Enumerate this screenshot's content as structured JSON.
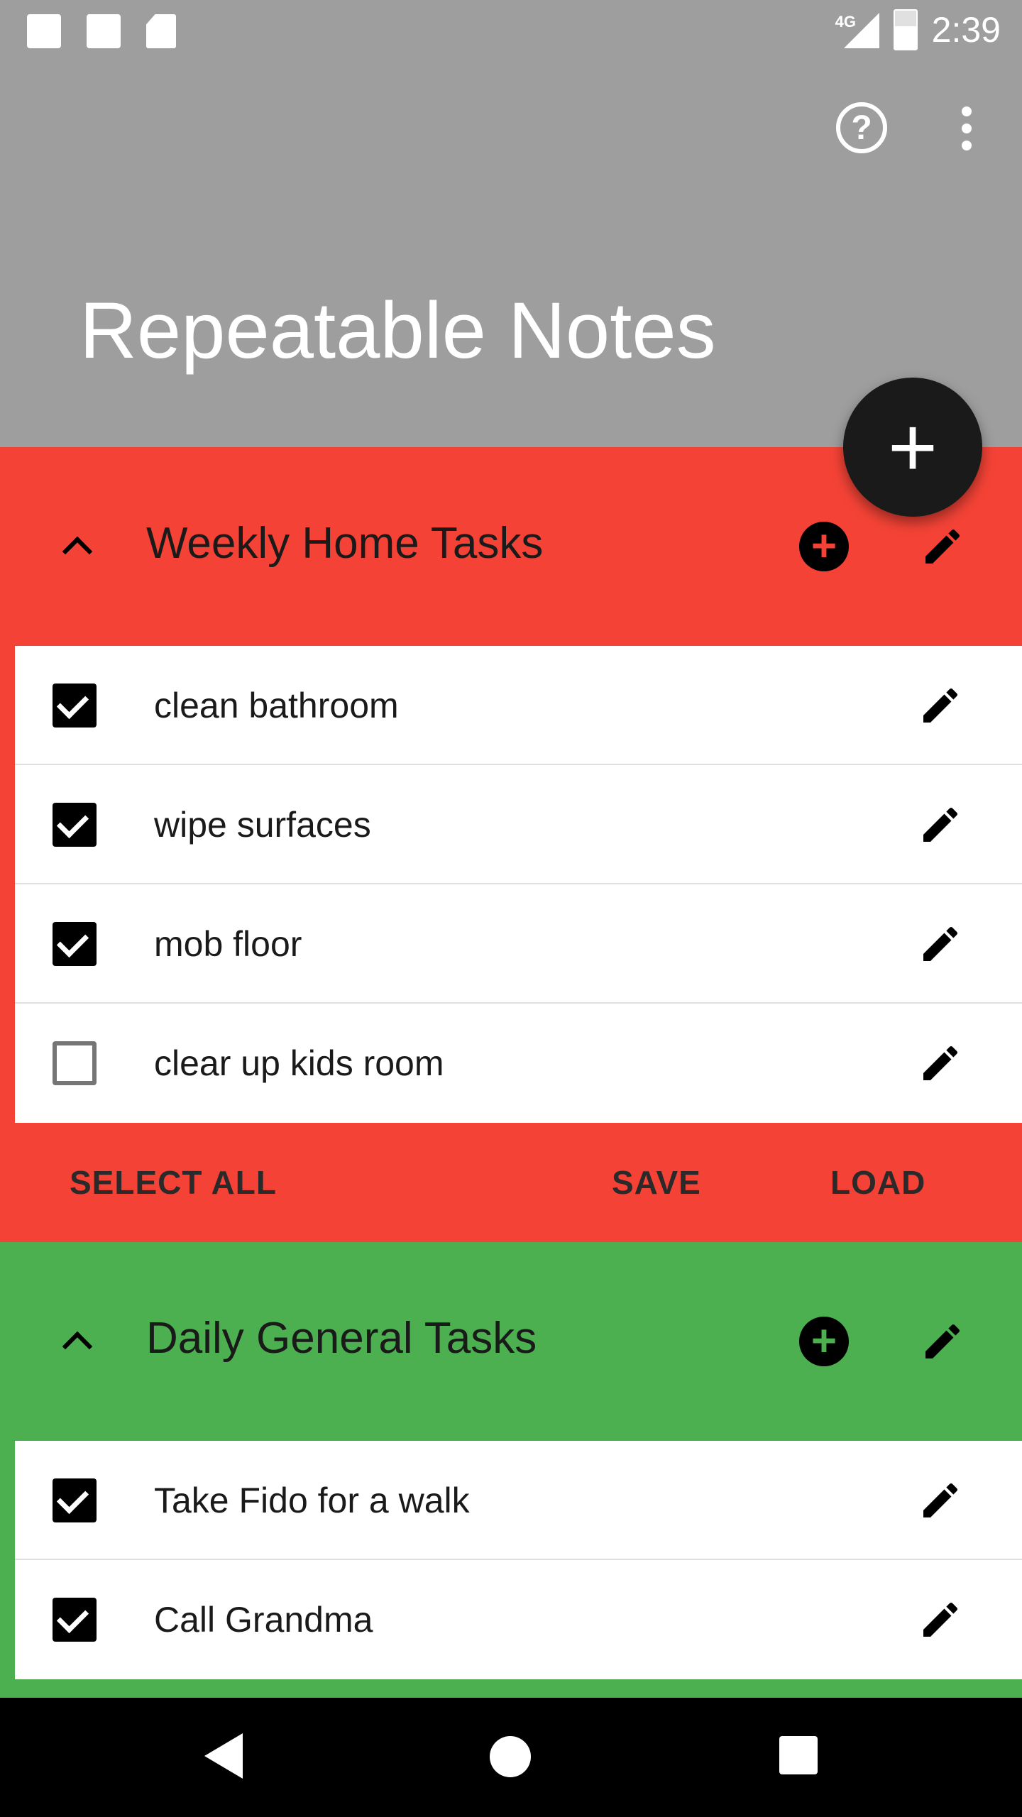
{
  "status_bar": {
    "network": "4G",
    "time": "2:39"
  },
  "app_bar": {
    "title": "Repeatable Notes",
    "help_icon": "help-circle-icon",
    "more_icon": "more-vert-icon",
    "help_glyph": "?"
  },
  "fab": {
    "icon": "add-icon",
    "glyph": "+"
  },
  "colors": {
    "app_bar": "#9e9e9e",
    "weekly": "#f44336",
    "daily": "#4caf50",
    "nav_bar": "#000000"
  },
  "lists": [
    {
      "title": "Weekly Home Tasks",
      "add_glyph": "+",
      "items": [
        {
          "text": "clean bathroom",
          "checked": true
        },
        {
          "text": "wipe surfaces",
          "checked": true
        },
        {
          "text": "mob floor",
          "checked": true
        },
        {
          "text": "clear up kids room",
          "checked": false
        }
      ],
      "actions": {
        "select_all": "SELECT ALL",
        "save": "SAVE",
        "load": "LOAD"
      }
    },
    {
      "title": "Daily General Tasks",
      "add_glyph": "+",
      "items": [
        {
          "text": "Take Fido for a walk",
          "checked": true
        },
        {
          "text": "Call Grandma",
          "checked": true
        }
      ]
    }
  ],
  "nav_bar": {
    "back_icon": "back-icon",
    "home_icon": "home-icon",
    "recents_icon": "recents-icon"
  }
}
